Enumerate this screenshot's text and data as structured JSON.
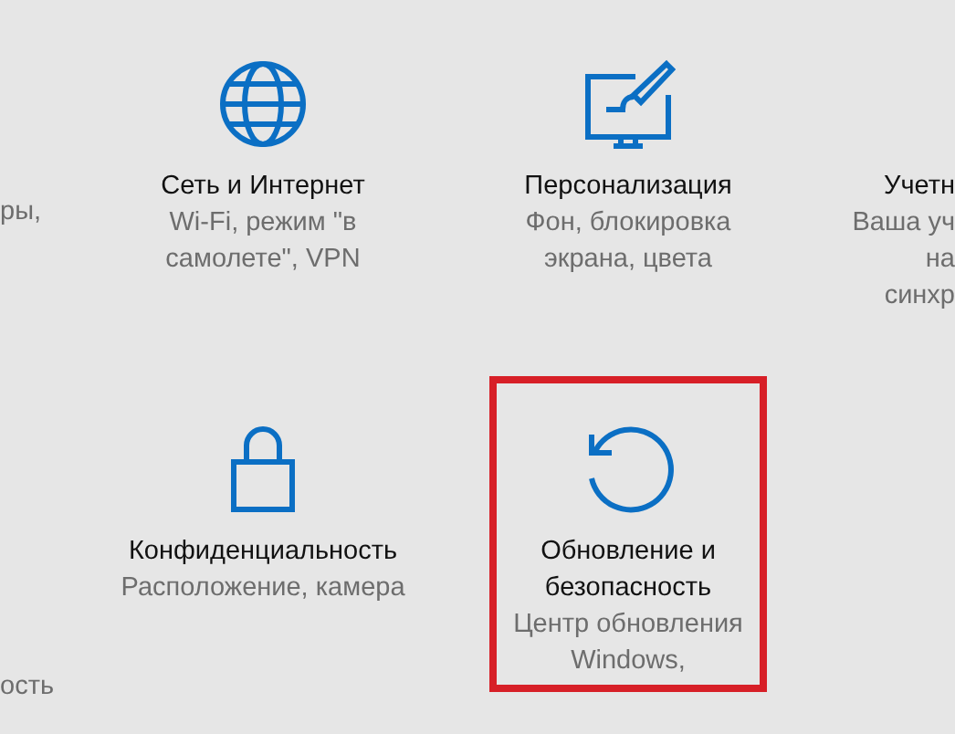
{
  "tiles": [
    {
      "kind": "edge-left",
      "description": [
        "ры,"
      ]
    },
    {
      "kind": "tile",
      "title": [
        "Сеть и Интернет"
      ],
      "description": [
        "Wi-Fi, режим \"в",
        "самолете\", VPN"
      ],
      "highlighted": false
    },
    {
      "kind": "tile",
      "title": [
        "Персонализация"
      ],
      "description": [
        "Фон, блокировка",
        "экрана, цвета"
      ],
      "highlighted": false
    },
    {
      "kind": "edge-right",
      "title": [
        "Учетн"
      ],
      "description": [
        "Ваша уч",
        "на",
        "синхр"
      ]
    },
    {
      "kind": "edge-left",
      "last_line": "ость"
    },
    {
      "kind": "tile",
      "title": [
        "Конфиденциальность"
      ],
      "description": [
        "Расположение, камера"
      ],
      "highlighted": false
    },
    {
      "kind": "tile",
      "title": [
        "Обновление и",
        "безопасность"
      ],
      "description": [
        "Центр обновления",
        "Windows,"
      ],
      "highlighted": true
    }
  ]
}
